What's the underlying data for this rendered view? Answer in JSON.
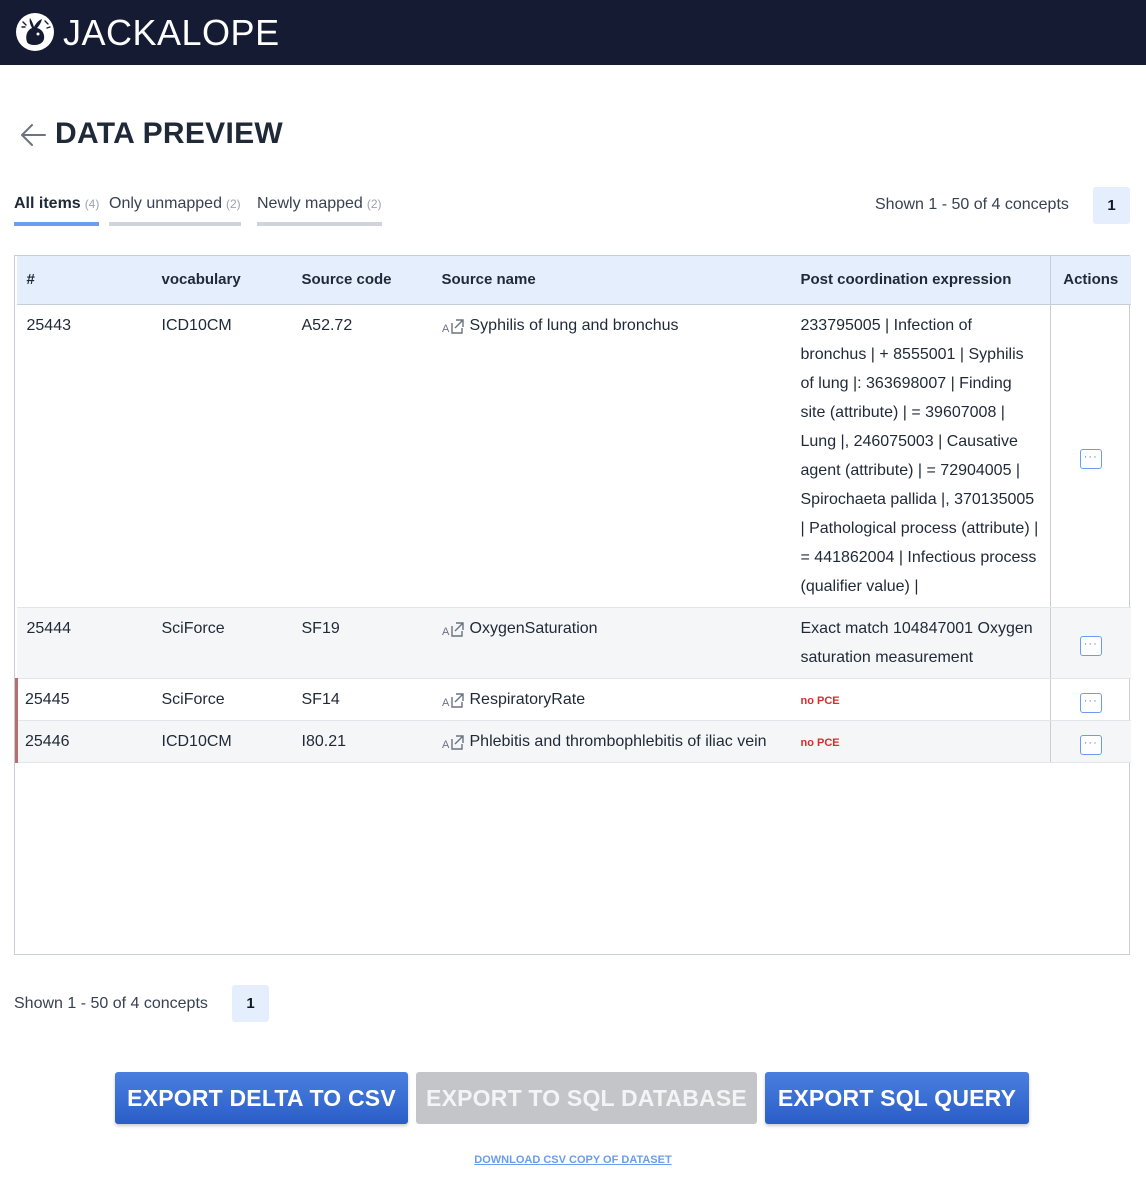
{
  "app": {
    "name": "JACKALOPE"
  },
  "page": {
    "title": "DATA PREVIEW"
  },
  "tabs": [
    {
      "label": "All items",
      "count": "(4)"
    },
    {
      "label": "Only unmapped",
      "count": "(2)"
    },
    {
      "label": "Newly mapped",
      "count": "(2)"
    }
  ],
  "pagination": {
    "shown_text": "Shown 1 - 50 of 4 concepts",
    "current_page": "1"
  },
  "table": {
    "headers": [
      "#",
      "vocabulary",
      "Source code",
      "Source name",
      "Post coordination expression",
      "Actions"
    ],
    "rows": [
      {
        "id": "25443",
        "vocabulary": "ICD10CM",
        "source_code": "A52.72",
        "source_name": "Syphilis of lung and bronchus",
        "pce": "233795005 | Infection of bronchus | + 8555001 | Syphilis of lung |: 363698007 | Finding site (attribute) | = 39607008 | Lung |, 246075003 | Causative agent (attribute) | = 72904005 | Spirochaeta pallida |, 370135005 | Pathological process (attribute) | = 441862004 | Infectious process (qualifier value) |",
        "no_pce": "",
        "action": "···"
      },
      {
        "id": "25444",
        "vocabulary": "SciForce",
        "source_code": "SF19",
        "source_name": "OxygenSaturation",
        "pce": "Exact match 104847001 Oxygen saturation measurement",
        "no_pce": "",
        "action": "···"
      },
      {
        "id": "25445",
        "vocabulary": "SciForce",
        "source_code": "SF14",
        "source_name": "RespiratoryRate",
        "pce": "",
        "no_pce": "no PCE",
        "action": "···"
      },
      {
        "id": "25446",
        "vocabulary": "ICD10CM",
        "source_code": "I80.21",
        "source_name": "Phlebitis and thrombophlebitis of iliac vein",
        "pce": "",
        "no_pce": "no PCE",
        "action": "···"
      }
    ]
  },
  "buttons": {
    "export_delta_csv": "EXPORT DELTA TO CSV",
    "export_sql_db": "EXPORT TO SQL DATABASE",
    "export_sql_query": "EXPORT SQL QUERY"
  },
  "download_link": "DOWNLOAD CSV COPY OF DATASET",
  "colors": {
    "topbar": "#141b33",
    "accent": "#6b9cee",
    "primary_button": "#2a5ec7",
    "no_pce": "#d32f2f",
    "header_bg": "#e4eefc"
  },
  "icons": {
    "logo": "jackalope-logo-icon",
    "back": "arrow-left-icon",
    "open": "external-link-icon",
    "actions": "more-dots-icon"
  }
}
